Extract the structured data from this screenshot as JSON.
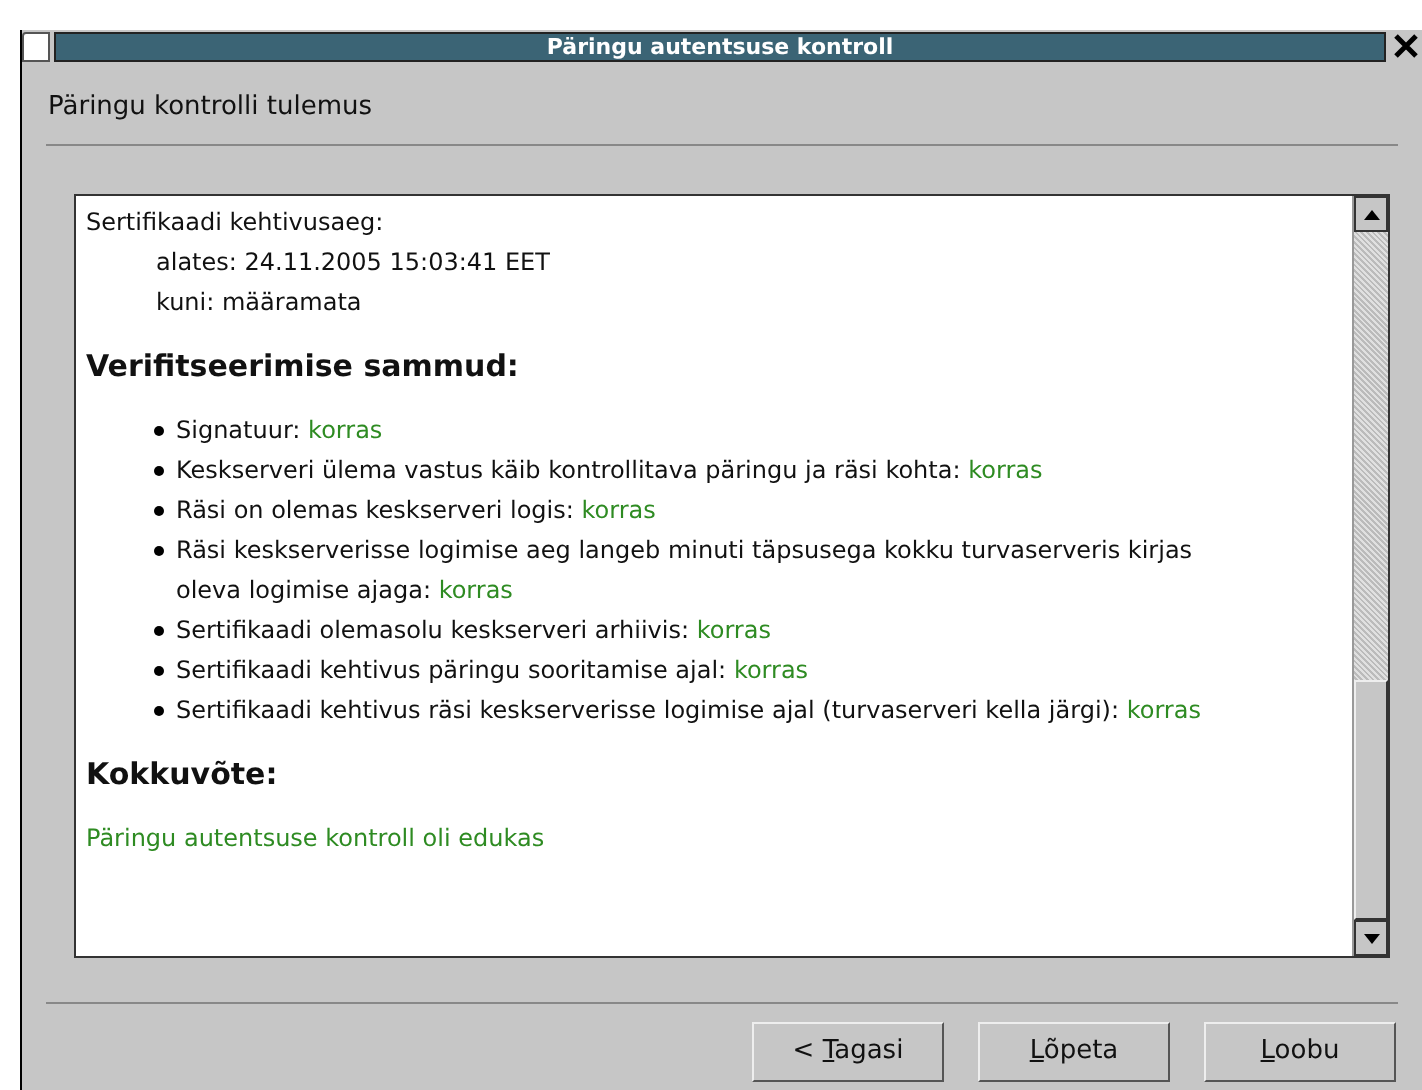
{
  "window": {
    "title": "Päringu autentsuse kontroll"
  },
  "header": "Päringu kontrolli tulemus",
  "certificate": {
    "label": "Sertifikaadi kehtivusaeg:",
    "lines": [
      "alates: 24.11.2005 15:03:41 EET",
      "kuni: määramata"
    ]
  },
  "steps_heading": "Verifitseerimise sammud:",
  "steps": [
    {
      "text": "Signatuur:",
      "status": "korras",
      "ok": true
    },
    {
      "text": "Keskserveri ülema vastus käib kontrollitava päringu ja räsi kohta:",
      "status": "korras",
      "ok": true
    },
    {
      "text": "Räsi on olemas keskserveri logis:",
      "status": "korras",
      "ok": true
    },
    {
      "text": "Räsi keskserverisse logimise aeg langeb minuti täpsusega kokku turvaserveris kirjas oleva logimise ajaga:",
      "status": "korras",
      "ok": true
    },
    {
      "text": "Sertifikaadi olemasolu keskserveri arhiivis:",
      "status": "korras",
      "ok": true
    },
    {
      "text": "Sertifikaadi kehtivus päringu sooritamise ajal:",
      "status": "korras",
      "ok": true
    },
    {
      "text": "Sertifikaadi kehtivus räsi keskserverisse logimise ajal (turvaserveri kella järgi):",
      "status": "korras",
      "ok": true
    }
  ],
  "summary_heading": "Kokkuvõte:",
  "summary": {
    "text": "Päringu autentsuse kontroll oli edukas",
    "ok": true
  },
  "buttons": [
    {
      "before": "< ",
      "mnemonic": "T",
      "after": "agasi"
    },
    {
      "mnemonic": "L",
      "after": "õpeta"
    },
    {
      "mnemonic": "L",
      "after": "oobu"
    }
  ]
}
